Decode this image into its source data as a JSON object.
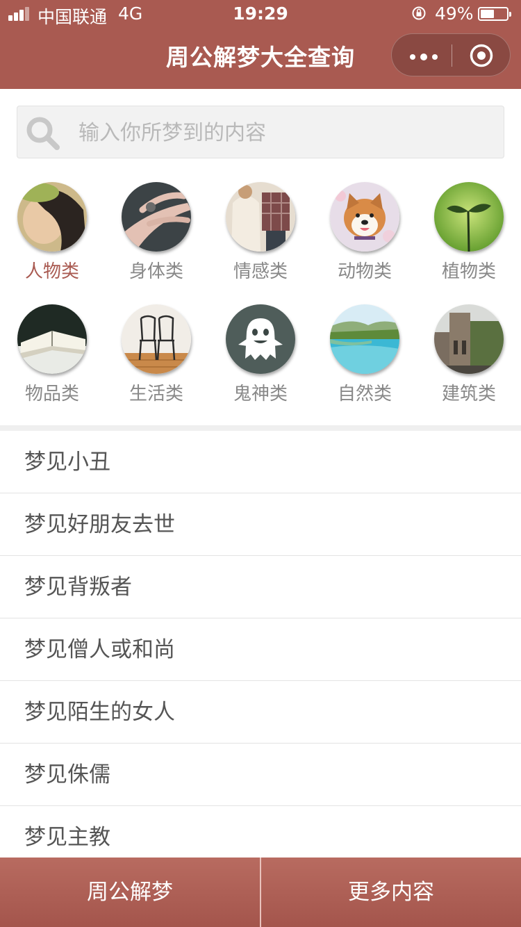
{
  "status_bar": {
    "carrier": "中国联通",
    "network": "4G",
    "time": "19:29",
    "battery": "49%",
    "battery_level": 0.49
  },
  "header": {
    "title": "周公解梦大全查询",
    "more_icon": "more-dots-icon",
    "close_icon": "target-close-icon"
  },
  "search": {
    "placeholder": "输入你所梦到的内容",
    "icon": "search-icon"
  },
  "categories": [
    {
      "label": "人物类",
      "active": true
    },
    {
      "label": "身体类"
    },
    {
      "label": "情感类"
    },
    {
      "label": "动物类"
    },
    {
      "label": "植物类"
    },
    {
      "label": "物品类"
    },
    {
      "label": "生活类"
    },
    {
      "label": "鬼神类"
    },
    {
      "label": "自然类"
    },
    {
      "label": "建筑类"
    }
  ],
  "dreams": [
    "梦见小丑",
    "梦见好朋友去世",
    "梦见背叛者",
    "梦见僧人或和尚",
    "梦见陌生的女人",
    "梦见侏儒",
    "梦见主教"
  ],
  "bottom_nav": {
    "left": "周公解梦",
    "right": "更多内容"
  },
  "colors": {
    "brand": "#a95a51",
    "active_label": "#a95a51",
    "label": "#888888",
    "list_text": "#555555"
  }
}
